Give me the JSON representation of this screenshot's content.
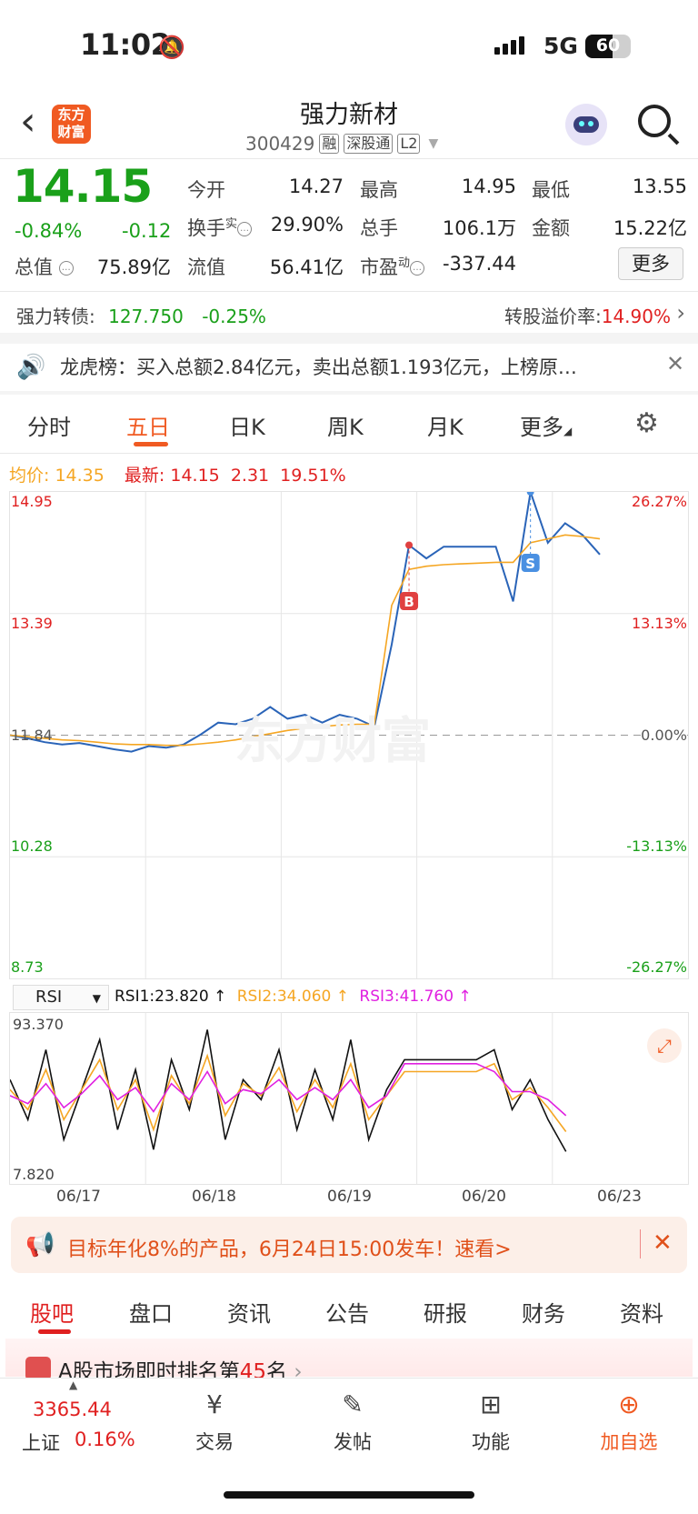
{
  "status": {
    "time": "11:02",
    "network": "5G",
    "battery": "60"
  },
  "header": {
    "logo_line1": "东方",
    "logo_line2": "财富",
    "title": "强力新材",
    "code": "300429",
    "tags": [
      "融",
      "深股通",
      "L2"
    ]
  },
  "quote": {
    "price": "14.15",
    "change_pct": "-0.84%",
    "change": "-0.12",
    "open_label": "今开",
    "open": "14.27",
    "high_label": "最高",
    "high": "14.95",
    "low_label": "最低",
    "low": "13.55",
    "turnover_label": "换手",
    "turnover_sup": "实",
    "turnover": "29.90%",
    "volume_label": "总手",
    "volume": "106.1万",
    "amount_label": "金额",
    "amount": "15.22亿",
    "total_mv_label": "总值",
    "total_mv": "75.89亿",
    "float_mv_label": "流值",
    "float_mv": "56.41亿",
    "pe_label": "市盈",
    "pe_sup": "动",
    "pe": "-337.44",
    "more_button": "更多"
  },
  "bond": {
    "label": "强力转债:",
    "price": "127.750",
    "change": "-0.25%",
    "premium_label": "转股溢价率:",
    "premium": "14.90%"
  },
  "dragon": {
    "text": "龙虎榜：买入总额2.84亿元，卖出总额1.193亿元，上榜原…"
  },
  "tabs": [
    "分时",
    "五日",
    "日K",
    "周K",
    "月K",
    "更多"
  ],
  "legend": {
    "avg_label": "均价:",
    "avg": "14.35",
    "latest_label": "最新:",
    "latest": "14.15",
    "latest_chg": "2.31",
    "latest_pct": "19.51%"
  },
  "rsi": {
    "selector": "RSI",
    "rsi1": "RSI1:23.820 ↑",
    "rsi2": "RSI2:34.060 ↑",
    "rsi3": "RSI3:41.760 ↑",
    "top": "93.370",
    "bottom": "7.820"
  },
  "promo": {
    "text": "目标年化8%的产品，6月24日15:00发车！速看>"
  },
  "bottom_tabs": [
    "股吧",
    "盘口",
    "资讯",
    "公告",
    "研报",
    "财务",
    "资料"
  ],
  "rank": {
    "text_prefix": "A股市场即时排名第",
    "rank_num": "45",
    "text_suffix": "名"
  },
  "bottom_bar": {
    "index_value": "3365.44",
    "index_name": "上证",
    "index_change": "0.16%",
    "trade": "交易",
    "post": "发帖",
    "func": "功能",
    "add": "加自选"
  },
  "chart_data": {
    "type": "line",
    "title": "",
    "y_left_ticks": [
      "14.95",
      "13.39",
      "11.84",
      "10.28",
      "8.73"
    ],
    "y_right_ticks": [
      "26.27%",
      "13.13%",
      "0.00%",
      "-13.13%",
      "-26.27%"
    ],
    "x_ticks": [
      "06/17",
      "06/18",
      "06/19",
      "06/20",
      "06/23"
    ],
    "ylim": [
      8.73,
      14.95
    ],
    "prev_close": 11.84,
    "series": [
      {
        "values": [
          11.84,
          11.8,
          11.75,
          11.72,
          11.74,
          11.7,
          11.66,
          11.63,
          11.7,
          11.68,
          11.72,
          11.85,
          12.0,
          11.98,
          12.05,
          12.2,
          12.05,
          12.1,
          12.0,
          12.1,
          12.05,
          11.95,
          13.0,
          14.27,
          14.1,
          14.25,
          14.25,
          14.25,
          14.25,
          13.55,
          14.95,
          14.3,
          14.55,
          14.4,
          14.15
        ]
      },
      {
        "values": [
          11.84,
          11.82,
          11.8,
          11.78,
          11.77,
          11.75,
          11.73,
          11.72,
          11.72,
          11.71,
          11.71,
          11.73,
          11.75,
          11.78,
          11.82,
          11.86,
          11.9,
          11.93,
          11.95,
          11.97,
          11.98,
          11.98,
          13.5,
          13.96,
          14.0,
          14.02,
          14.03,
          14.04,
          14.05,
          14.05,
          14.3,
          14.35,
          14.4,
          14.38,
          14.35
        ]
      }
    ],
    "markers": [
      {
        "label": "B",
        "price": 14.27
      },
      {
        "label": "S",
        "price": 14.95
      }
    ],
    "rsi_series": [
      {
        "name": "RSI1",
        "values": [
          60,
          40,
          75,
          30,
          55,
          80,
          35,
          65,
          25,
          70,
          45,
          85,
          30,
          60,
          50,
          75,
          35,
          65,
          40,
          80,
          30,
          55,
          70,
          70,
          70,
          70,
          70,
          75,
          45,
          60,
          40,
          24
        ]
      },
      {
        "name": "RSI2",
        "values": [
          55,
          45,
          65,
          40,
          55,
          70,
          45,
          60,
          35,
          62,
          48,
          72,
          42,
          58,
          52,
          66,
          44,
          60,
          46,
          68,
          40,
          52,
          64,
          64,
          64,
          64,
          64,
          68,
          50,
          56,
          46,
          34
        ]
      },
      {
        "name": "RSI3",
        "values": [
          52,
          48,
          58,
          46,
          53,
          62,
          50,
          56,
          44,
          58,
          50,
          64,
          48,
          55,
          53,
          60,
          50,
          56,
          50,
          60,
          46,
          52,
          68,
          68,
          68,
          68,
          68,
          64,
          54,
          54,
          50,
          42
        ]
      }
    ]
  }
}
